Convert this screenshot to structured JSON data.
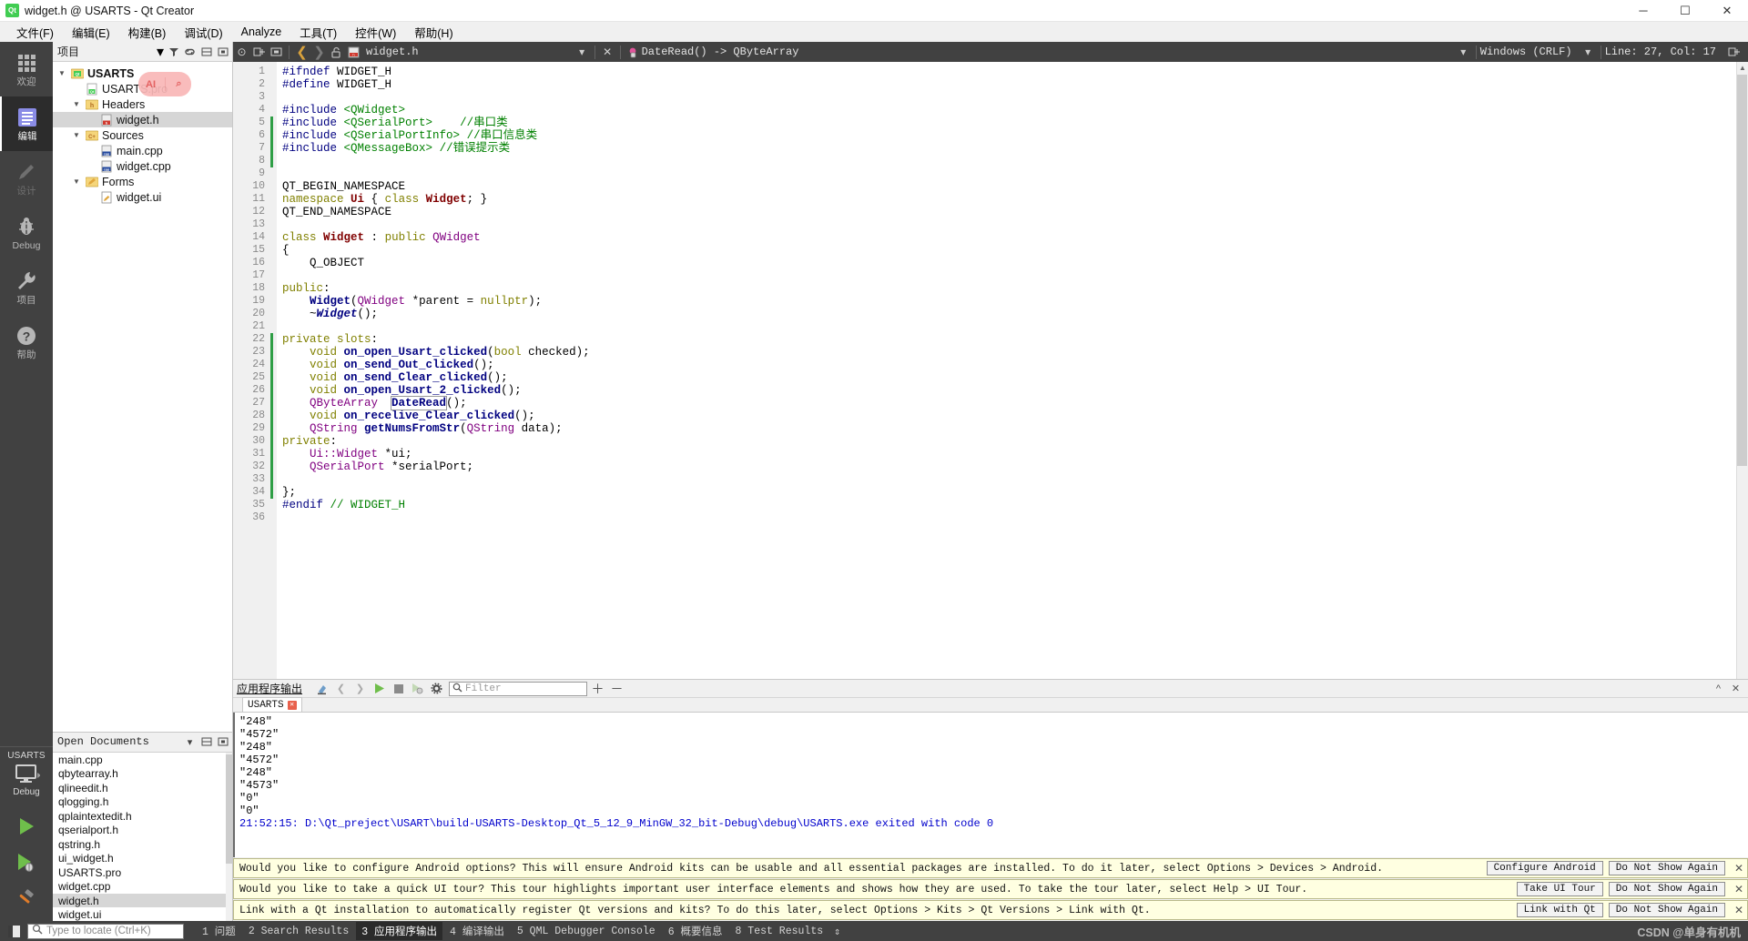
{
  "window": {
    "title": "widget.h @ USARTS - Qt Creator",
    "logo_text": "Qt",
    "minimize": "─",
    "maximize": "☐",
    "close": "✕"
  },
  "menubar": {
    "items": [
      {
        "label": "文件(F)",
        "name": "menu-file"
      },
      {
        "label": "编辑(E)",
        "name": "menu-edit"
      },
      {
        "label": "构建(B)",
        "name": "menu-build"
      },
      {
        "label": "调试(D)",
        "name": "menu-debug"
      },
      {
        "label": "Analyze",
        "name": "menu-analyze"
      },
      {
        "label": "工具(T)",
        "name": "menu-tools"
      },
      {
        "label": "控件(W)",
        "name": "menu-window"
      },
      {
        "label": "帮助(H)",
        "name": "menu-help"
      }
    ]
  },
  "modebar": {
    "modes": [
      {
        "label": "欢迎",
        "icon": "grid-icon",
        "state": "normal"
      },
      {
        "label": "编辑",
        "icon": "document-icon",
        "state": "active"
      },
      {
        "label": "设计",
        "icon": "pencil-icon",
        "state": "disabled"
      },
      {
        "label": "Debug",
        "icon": "bug-icon",
        "state": "normal"
      },
      {
        "label": "项目",
        "icon": "wrench-icon",
        "state": "normal"
      },
      {
        "label": "帮助",
        "icon": "question-icon",
        "state": "normal"
      }
    ],
    "kit": {
      "name": "USARTS",
      "build_config": "Debug",
      "icon": "monitor-icon"
    },
    "run_buttons": [
      {
        "name": "run-button",
        "icon": "play-icon"
      },
      {
        "name": "debug-button",
        "icon": "play-bug-icon"
      },
      {
        "name": "build-button",
        "icon": "hammer-icon"
      }
    ]
  },
  "project_dock": {
    "title": "项目",
    "toolbar_icons": [
      "chevron-down-icon",
      "filter-icon",
      "link-icon",
      "split-icon",
      "close-split-icon"
    ],
    "tree": [
      {
        "depth": 0,
        "label": "USARTS",
        "arrow": "down",
        "icon": "qt-project-icon",
        "bold": true,
        "selected": false
      },
      {
        "depth": 1,
        "label": "USARTS.pro",
        "arrow": "none",
        "icon": "pro-file-icon",
        "bold": false,
        "selected": false
      },
      {
        "depth": 1,
        "label": "Headers",
        "arrow": "down",
        "icon": "h-folder-icon",
        "bold": false,
        "selected": false
      },
      {
        "depth": 2,
        "label": "widget.h",
        "arrow": "none",
        "icon": "h-file-icon",
        "bold": false,
        "selected": true
      },
      {
        "depth": 1,
        "label": "Sources",
        "arrow": "down",
        "icon": "cpp-folder-icon",
        "bold": false,
        "selected": false
      },
      {
        "depth": 2,
        "label": "main.cpp",
        "arrow": "none",
        "icon": "cpp-file-icon",
        "bold": false,
        "selected": false
      },
      {
        "depth": 2,
        "label": "widget.cpp",
        "arrow": "none",
        "icon": "cpp-file-icon",
        "bold": false,
        "selected": false
      },
      {
        "depth": 1,
        "label": "Forms",
        "arrow": "down",
        "icon": "ui-folder-icon",
        "bold": false,
        "selected": false
      },
      {
        "depth": 2,
        "label": "widget.ui",
        "arrow": "none",
        "icon": "ui-file-icon",
        "bold": false,
        "selected": false
      }
    ]
  },
  "ai_pill": {
    "label_left": "AI",
    "label_right": "⌕"
  },
  "open_documents": {
    "title": "Open Documents",
    "items": [
      {
        "label": "main.cpp",
        "selected": false
      },
      {
        "label": "qbytearray.h",
        "selected": false
      },
      {
        "label": "qlineedit.h",
        "selected": false
      },
      {
        "label": "qlogging.h",
        "selected": false
      },
      {
        "label": "qplaintextedit.h",
        "selected": false
      },
      {
        "label": "qserialport.h",
        "selected": false
      },
      {
        "label": "qstring.h",
        "selected": false
      },
      {
        "label": "ui_widget.h",
        "selected": false
      },
      {
        "label": "USARTS.pro",
        "selected": false
      },
      {
        "label": "widget.cpp",
        "selected": false
      },
      {
        "label": "widget.h",
        "selected": true
      },
      {
        "label": "widget.ui",
        "selected": false
      }
    ]
  },
  "editor_toolbar": {
    "back_icon": "back-arrow-icon",
    "forward_icon": "forward-arrow-icon",
    "lock_icon": "unlock-icon",
    "file_icon": "h-file-icon",
    "filename": "widget.h",
    "dropdown_icon": "chevron-down-icon",
    "close_icon": "close-icon",
    "symbol_icon": "function-icon",
    "symbol": "DateRead() -> QByteArray",
    "line_ending": "Windows (CRLF)",
    "cursor_position": "Line: 27, Col: 17",
    "split_icon": "split-editor-icon"
  },
  "code": {
    "first_line": 1,
    "last_line": 36,
    "modified_lines": [
      5,
      6,
      7,
      8,
      22,
      23,
      24,
      25,
      26,
      27,
      28,
      29,
      30,
      31,
      32,
      33,
      34
    ],
    "fold_lines": [
      14
    ],
    "lines": [
      {
        "n": 1,
        "html": "<span class=\"pp\">#ifndef</span> WIDGET_H"
      },
      {
        "n": 2,
        "html": "<span class=\"pp\">#define</span> WIDGET_H"
      },
      {
        "n": 3,
        "html": ""
      },
      {
        "n": 4,
        "html": "<span class=\"pp\">#include</span> <span class=\"str\">&lt;QWidget&gt;</span>"
      },
      {
        "n": 5,
        "html": "<span class=\"pp\">#include</span> <span class=\"str\">&lt;QSerialPort&gt;</span>    <span class=\"cm\">//串口类</span>"
      },
      {
        "n": 6,
        "html": "<span class=\"pp\">#include</span> <span class=\"str\">&lt;QSerialPortInfo&gt;</span> <span class=\"cm\">//串口信息类</span>"
      },
      {
        "n": 7,
        "html": "<span class=\"pp\">#include</span> <span class=\"str\">&lt;QMessageBox&gt;</span> <span class=\"cm\">//错误提示类</span>"
      },
      {
        "n": 8,
        "html": ""
      },
      {
        "n": 9,
        "html": ""
      },
      {
        "n": 10,
        "html": "QT_BEGIN_NAMESPACE"
      },
      {
        "n": 11,
        "html": "<span class=\"k\">namespace</span> <span class=\"cls\">Ui</span> { <span class=\"k\">class</span> <span class=\"cls\">Widget</span>; }"
      },
      {
        "n": 12,
        "html": "QT_END_NAMESPACE"
      },
      {
        "n": 13,
        "html": ""
      },
      {
        "n": 14,
        "html": "<span class=\"k\">class</span> <span class=\"cls\">Widget</span> : <span class=\"k\">public</span> <span class=\"ty\">QWidget</span>"
      },
      {
        "n": 15,
        "html": "{"
      },
      {
        "n": 16,
        "html": "    Q_OBJECT"
      },
      {
        "n": 17,
        "html": ""
      },
      {
        "n": 18,
        "html": "<span class=\"k\">public</span>:"
      },
      {
        "n": 19,
        "html": "    <span class=\"fn\">Widget</span>(<span class=\"ty\">QWidget</span> *parent = <span class=\"k\">nullptr</span>);"
      },
      {
        "n": 20,
        "html": "    ~<span class=\"vir\">Widget</span>();"
      },
      {
        "n": 21,
        "html": ""
      },
      {
        "n": 22,
        "html": "<span class=\"k\">private slots</span>:"
      },
      {
        "n": 23,
        "html": "    <span class=\"k\">void</span> <span class=\"fn\">on_open_Usart_clicked</span>(<span class=\"k\">bool</span> checked);"
      },
      {
        "n": 24,
        "html": "    <span class=\"k\">void</span> <span class=\"fn\">on_send_Out_clicked</span>();"
      },
      {
        "n": 25,
        "html": "    <span class=\"k\">void</span> <span class=\"fn\">on_send_Clear_clicked</span>();"
      },
      {
        "n": 26,
        "html": "    <span class=\"k\">void</span> <span class=\"fn\">on_open_Usart_2_clicked</span>();"
      },
      {
        "n": 27,
        "html": "    <span class=\"ty\">QByteArray</span>  <span class=\"hl\"><span class=\"fn\">DateRead</span></span>();"
      },
      {
        "n": 28,
        "html": "    <span class=\"k\">void</span> <span class=\"fn\">on_recelive_Clear_clicked</span>();"
      },
      {
        "n": 29,
        "html": "    <span class=\"ty\">QString</span> <span class=\"fn\">getNumsFromStr</span>(<span class=\"ty\">QString</span> data);"
      },
      {
        "n": 30,
        "html": "<span class=\"k\">private</span>:"
      },
      {
        "n": 31,
        "html": "    <span class=\"ty\">Ui::Widget</span> *ui;"
      },
      {
        "n": 32,
        "html": "    <span class=\"ty\">QSerialPort</span> *serialPort;"
      },
      {
        "n": 33,
        "html": ""
      },
      {
        "n": 34,
        "html": "};"
      },
      {
        "n": 35,
        "html": "<span class=\"pp\">#endif</span> <span class=\"cm\">// WIDGET_H</span>"
      },
      {
        "n": 36,
        "html": ""
      }
    ]
  },
  "output_pane": {
    "title": "应用程序输出",
    "toolbar_icons": [
      "clear-icon",
      "prev-icon",
      "next-icon",
      "run-icon",
      "stop-icon",
      "attach-icon",
      "gear-icon"
    ],
    "filter_placeholder": "Filter",
    "add_icon": "plus-icon",
    "remove_icon": "minus-icon",
    "maximize_icon": "chevron-up-icon",
    "close_icon": "close-icon",
    "tab": {
      "label": "USARTS",
      "close": "✕"
    },
    "lines": [
      {
        "text": "\"248\"",
        "kind": "plain"
      },
      {
        "text": "\"4572\"",
        "kind": "plain"
      },
      {
        "text": "\"248\"",
        "kind": "plain"
      },
      {
        "text": "\"4572\"",
        "kind": "plain"
      },
      {
        "text": "\"248\"",
        "kind": "plain"
      },
      {
        "text": "\"4573\"",
        "kind": "plain"
      },
      {
        "text": "\"0\"",
        "kind": "plain"
      },
      {
        "text": "\"0\"",
        "kind": "plain"
      },
      {
        "text": "21:52:15: D:\\Qt_preject\\USART\\build-USARTS-Desktop_Qt_5_12_9_MinGW_32_bit-Debug\\debug\\USARTS.exe exited with code 0",
        "kind": "timestamp"
      }
    ]
  },
  "banners": [
    {
      "message": "Would you like to configure Android options? This will ensure Android kits can be usable and all essential packages are installed. To do it later, select Options > Devices > Android.",
      "primary": "Configure Android",
      "secondary": "Do Not Show Again",
      "close": "✕"
    },
    {
      "message": "Would you like to take a quick UI tour? This tour highlights important user interface elements and shows how they are used. To take the tour later, select Help > UI Tour.",
      "primary": "Take UI Tour",
      "secondary": "Do Not Show Again",
      "close": "✕"
    },
    {
      "message": "Link with a Qt installation to automatically register Qt versions and kits? To do this later, select Options > Kits > Qt Versions > Link with Qt.",
      "primary": "Link with Qt",
      "secondary": "Do Not Show Again",
      "close": "✕"
    }
  ],
  "statusbar": {
    "sidebar_toggle_icon": "sidebar-toggle-icon",
    "locator_placeholder": "Type to locate (Ctrl+K)",
    "search_icon": "search-icon",
    "tabs": [
      {
        "label": "1 问题",
        "active": false
      },
      {
        "label": "2 Search Results",
        "active": false
      },
      {
        "label": "3 应用程序输出",
        "active": true
      },
      {
        "label": "4 编译输出",
        "active": false
      },
      {
        "label": "5 QML Debugger Console",
        "active": false
      },
      {
        "label": "6 概要信息",
        "active": false
      },
      {
        "label": "8 Test Results",
        "active": false
      }
    ],
    "expand_icon": "updown-icon",
    "watermark": "CSDN @单身有机机"
  }
}
